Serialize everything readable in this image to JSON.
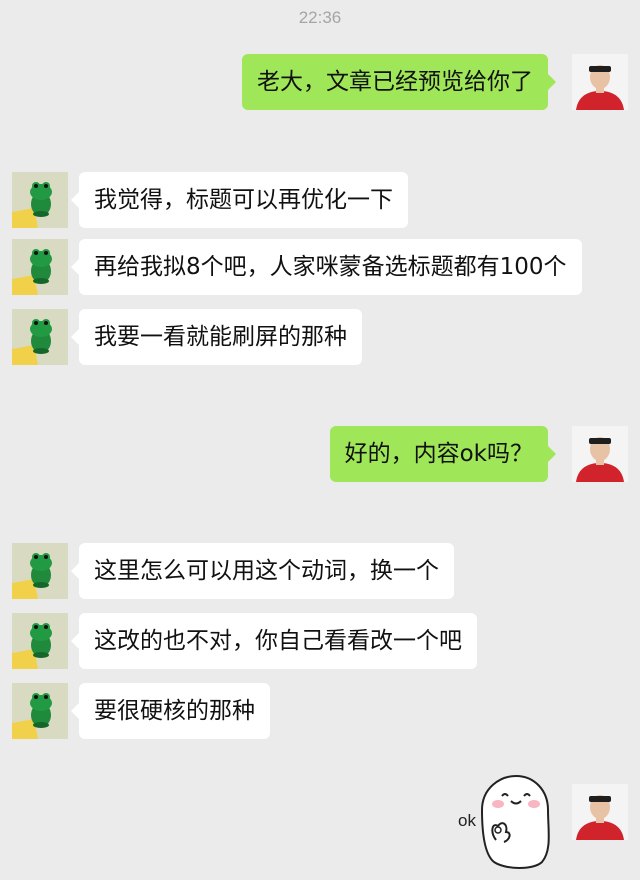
{
  "chat": {
    "timestamp": "22:36",
    "messages": [
      {
        "sender": "me",
        "text": "老大，文章已经预览给你了"
      },
      {
        "sender": "boss",
        "text": "我觉得，标题可以再优化一下"
      },
      {
        "sender": "boss",
        "text": "再给我拟8个吧，人家咪蒙备选标题都有100个"
      },
      {
        "sender": "boss",
        "text": "我要一看就能刷屏的那种"
      },
      {
        "sender": "me",
        "text": "好的，内容ok吗？"
      },
      {
        "sender": "boss",
        "text": "这里怎么可以用这个动词，换一个"
      },
      {
        "sender": "boss",
        "text": "这改的也不对，你自己看看改一个吧"
      },
      {
        "sender": "boss",
        "text": "要很硬核的那种"
      },
      {
        "sender": "me",
        "sticker": "ok-sticker",
        "sticker_text": "ok"
      }
    ]
  },
  "colors": {
    "background": "#ebebeb",
    "my_bubble": "#9fe658",
    "their_bubble": "#ffffff",
    "timestamp": "#a5a5a5"
  },
  "icons": {
    "my_avatar": "person-avatar-red-shirt",
    "boss_avatar": "green-frog-figurine-avatar",
    "sticker": "white-blob-ok-hand-sticker"
  }
}
